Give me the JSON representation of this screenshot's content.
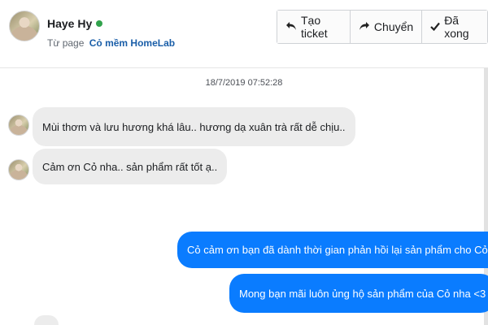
{
  "header": {
    "name": "Haye Hy",
    "from_prefix": "Từ page",
    "page_name": "Cỏ mềm HomeLab",
    "online_color": "#31a24c",
    "buttons": [
      {
        "label": "Tạo ticket",
        "icon": "reply-icon"
      },
      {
        "label": "Chuyển",
        "icon": "forward-icon"
      },
      {
        "label": "Đã xong",
        "icon": "check-icon"
      }
    ]
  },
  "conversation": {
    "timestamp": "18/7/2019 07:52:28",
    "incoming": [
      {
        "text": "Mùi thơm và lưu hương khá lâu.. hương dạ xuân trà rất dễ chịu.."
      },
      {
        "text": "Cảm ơn Cỏ nha.. sản phẩm rất tốt ạ.."
      }
    ],
    "outgoing": [
      {
        "text": "Cỏ cảm ơn bạn đã dành thời gian phản hồi lại sản phẩm cho Cỏ ạ"
      },
      {
        "text": "Mong bạn mãi luôn ủng hộ sản phẩm của Cỏ nha <3"
      }
    ]
  },
  "colors": {
    "outgoing_bubble": "#0a7cff",
    "incoming_bubble": "#ececec",
    "page_link": "#1a5ea8"
  }
}
